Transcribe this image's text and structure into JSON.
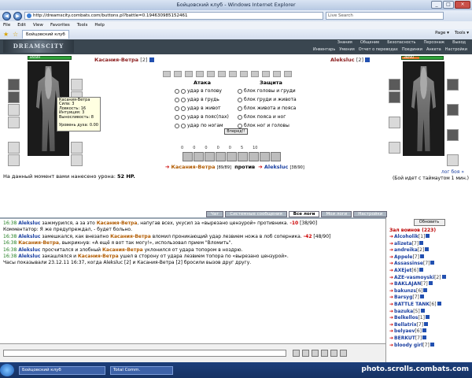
{
  "window": {
    "title": "Бойцовский клуб - Windows Internet Explorer",
    "url": "http://dreamscity.combats.com/buttons.pl?battle=0.194630985152461"
  },
  "menu": [
    "File",
    "Edit",
    "View",
    "Favorites",
    "Tools",
    "Help"
  ],
  "tab": {
    "label": "Бойцовский клуб"
  },
  "toolbar_right": [
    "Page ▾",
    "Tools ▾"
  ],
  "game": {
    "logo": "DREAMSCITY",
    "nav": [
      "Знания",
      "Общение",
      "Безопасность",
      "Персонаж",
      "Выход"
    ],
    "nav2": [
      "Инвентарь",
      "Умения",
      "Отчет о переводах",
      "Поединки",
      "Анкета",
      "Настройки"
    ]
  },
  "player": {
    "name": "Касания-Ветра",
    "level": "[2]",
    "hp": "89/89"
  },
  "enemy": {
    "name": "Aleksluc",
    "level": "[2]",
    "hp": "38/90"
  },
  "tooltip": [
    "Касания-Ветра",
    "Сила: 3",
    "Ловкость: 16",
    "Интуиция: 3",
    "Выносливость: 8",
    "",
    "Уровень духа: 0.00"
  ],
  "attack": {
    "title": "Атака",
    "options": [
      "удар в голову",
      "удар в грудь",
      "удар в живот",
      "удар в пояс(пах)",
      "удар по ногам"
    ]
  },
  "defense": {
    "title": "Защита",
    "options": [
      "блок головы и груди",
      "блок груди и живота",
      "блок живота и пояса",
      "блок пояса и ног",
      "блок ног и головы"
    ]
  },
  "forward": "Вперед!!",
  "counters": [
    "0",
    "0",
    "0",
    "0",
    "0",
    "5",
    "10"
  ],
  "versus": {
    "left": "Касания-Ветра",
    "left_hp": "[89/89]",
    "mid": "против",
    "right": "Aleksluc",
    "right_hp": "[38/90]"
  },
  "damage": {
    "text": "На данный момент вами нанесено урона: ",
    "value": "52 HP."
  },
  "log": {
    "link": "лог боя »",
    "timeout": "(Бой идет с таймаутом 1 мин.)"
  },
  "chat_tabs": [
    "Чат",
    "Системные сообщения",
    "Все логи",
    "Мои логи",
    "Настройки"
  ],
  "chat": [
    {
      "time": "16:38",
      "a": "Aleksluc",
      "text": " зажмурился, а за это ",
      "b": "Касания-Ветра",
      "text2": ", напугав всех, укусил за «вырезано цензурой» противника. ",
      "dmg": "-10",
      "hp": " [38/90]"
    },
    {
      "time": "",
      "a": "",
      "text": "Комментатор: Я же предупреждал, - будет больно.",
      "b": "",
      "text2": "",
      "dmg": "",
      "hp": ""
    },
    {
      "time": "16:38",
      "a": "Aleksluc",
      "text": " замешкался, как внезапно ",
      "b": "Касания-Ветра",
      "text2": " вломил проникающий удар лезвием ножа в лоб соперника. ",
      "dmg": "-42",
      "hp": " [48/90]"
    },
    {
      "time": "16:38",
      "a": "",
      "text": "",
      "b": "Касания-Ветра",
      "text2": ", выкрикнув: «А ещё я вот так могу!», использовал прием \"Вломить\".",
      "dmg": "",
      "hp": ""
    },
    {
      "time": "16:38",
      "a": "Aleksluc",
      "text": " просчитался и злобный ",
      "b": "Касания-Ветра",
      "text2": " уклонился от удара топором в ноздрю.",
      "dmg": "",
      "hp": ""
    },
    {
      "time": "16:38",
      "a": "Aleksluc",
      "text": " закашлялся и ",
      "b": "Касания-Ветра",
      "text2": " ушел в сторону от удара лезвием топора по «вырезано цензурой».",
      "dmg": "",
      "hp": ""
    },
    {
      "time": "",
      "a": "",
      "text": "Часы показывали 23.12.11 16:37, когда Aleksluc [2] и Касания-Ветра [2] бросили вызов друг другу.",
      "b": "",
      "text2": "",
      "dmg": "",
      "hp": ""
    }
  ],
  "sidebar": {
    "refresh": "Обновить",
    "header": "Зал воинов (223)",
    "users": [
      {
        "name": "Alcoholik",
        "lvl": "[1]"
      },
      {
        "name": "alizeta",
        "lvl": "[7]"
      },
      {
        "name": "andreika",
        "lvl": "[2]"
      },
      {
        "name": "Appele",
        "lvl": "[7]"
      },
      {
        "name": "Assassinse",
        "lvl": "[7]"
      },
      {
        "name": "AXEjet",
        "lvl": "[6]"
      },
      {
        "name": "AZE-vasmoyski",
        "lvl": "[2]"
      },
      {
        "name": "BAKLAJAN",
        "lvl": "[7]"
      },
      {
        "name": "bakunzs",
        "lvl": "[6]"
      },
      {
        "name": "Barsyg",
        "lvl": "[7]"
      },
      {
        "name": "BATTLE TANK",
        "lvl": "[6]"
      },
      {
        "name": "bazuka",
        "lvl": "[5]"
      },
      {
        "name": "Belkellos",
        "lvl": "[1]"
      },
      {
        "name": "Bellatrix",
        "lvl": "[7]"
      },
      {
        "name": "belyaev",
        "lvl": "[6]"
      },
      {
        "name": "BERKUT",
        "lvl": "[7]"
      },
      {
        "name": "bloody girl",
        "lvl": "[7]"
      }
    ]
  },
  "taskbar": [
    "Бойцовский клуб",
    "Total Comm."
  ],
  "watermark": "photo.scrolls.combats.com"
}
